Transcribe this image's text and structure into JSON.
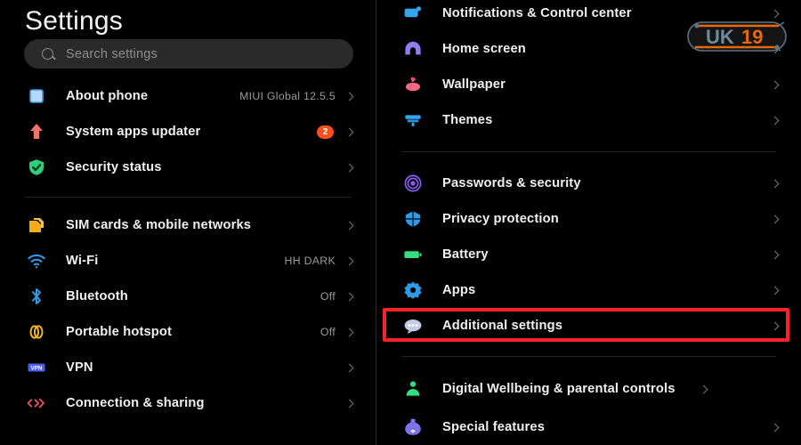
{
  "header": {
    "title": "Settings"
  },
  "search": {
    "placeholder": "Search settings",
    "icon": "search-icon",
    "value": ""
  },
  "colors": {
    "background": "#000000",
    "text_primary": "#f0f0f0",
    "text_secondary": "#9a9a9a",
    "badge": "#f4511e",
    "highlight_box": "#f8232a",
    "divider": "#232323",
    "search_field": "#2a2a2a"
  },
  "left_column": {
    "groups": [
      {
        "items": [
          {
            "label": "About phone",
            "value": "MIUI Global 12.5.5",
            "badge": "",
            "icon": "about-phone-icon",
            "chevron": true
          },
          {
            "label": "System apps updater",
            "value": "",
            "badge": "2",
            "icon": "system-updater-icon",
            "chevron": true
          },
          {
            "label": "Security status",
            "value": "",
            "badge": "",
            "icon": "security-shield-icon",
            "chevron": true
          }
        ]
      },
      {
        "items": [
          {
            "label": "SIM cards & mobile networks",
            "value": "",
            "badge": "",
            "icon": "sim-cards-icon",
            "chevron": true
          },
          {
            "label": "Wi-Fi",
            "value": "HH DARK",
            "badge": "",
            "icon": "wifi-icon",
            "chevron": true
          },
          {
            "label": "Bluetooth",
            "value": "Off",
            "badge": "",
            "icon": "bluetooth-icon",
            "chevron": true
          },
          {
            "label": "Portable hotspot",
            "value": "Off",
            "badge": "",
            "icon": "hotspot-icon",
            "chevron": true
          },
          {
            "label": "VPN",
            "value": "",
            "badge": "",
            "icon": "vpn-icon",
            "chevron": true
          },
          {
            "label": "Connection & sharing",
            "value": "",
            "badge": "",
            "icon": "connection-sharing-icon",
            "chevron": true
          }
        ]
      }
    ]
  },
  "right_column": {
    "groups": [
      {
        "items": [
          {
            "label": "Notifications & Control center",
            "value": "",
            "icon": "notifications-icon",
            "chevron": true
          },
          {
            "label": "Home screen",
            "value": "",
            "icon": "home-screen-icon",
            "chevron": true
          },
          {
            "label": "Wallpaper",
            "value": "",
            "icon": "wallpaper-icon",
            "chevron": true
          },
          {
            "label": "Themes",
            "value": "",
            "icon": "themes-icon",
            "chevron": true
          }
        ]
      },
      {
        "items": [
          {
            "label": "Passwords & security",
            "value": "",
            "icon": "passwords-security-icon",
            "chevron": true
          },
          {
            "label": "Privacy protection",
            "value": "",
            "icon": "privacy-protection-icon",
            "chevron": true
          },
          {
            "label": "Battery",
            "value": "",
            "icon": "battery-icon",
            "chevron": true
          },
          {
            "label": "Apps",
            "value": "",
            "icon": "apps-icon",
            "chevron": true
          },
          {
            "label": "Additional settings",
            "value": "",
            "icon": "additional-settings-icon",
            "chevron": true,
            "highlighted": true
          }
        ]
      },
      {
        "items": [
          {
            "label": "Digital Wellbeing & parental controls",
            "value": "",
            "icon": "digital-wellbeing-icon",
            "chevron": true
          },
          {
            "label": "Special features",
            "value": "",
            "icon": "special-features-icon",
            "chevron": true
          }
        ]
      }
    ]
  },
  "watermark": {
    "text_left": "UK",
    "text_right": "19",
    "color_left": "#6f8a9c",
    "color_right": "#e8690b"
  }
}
